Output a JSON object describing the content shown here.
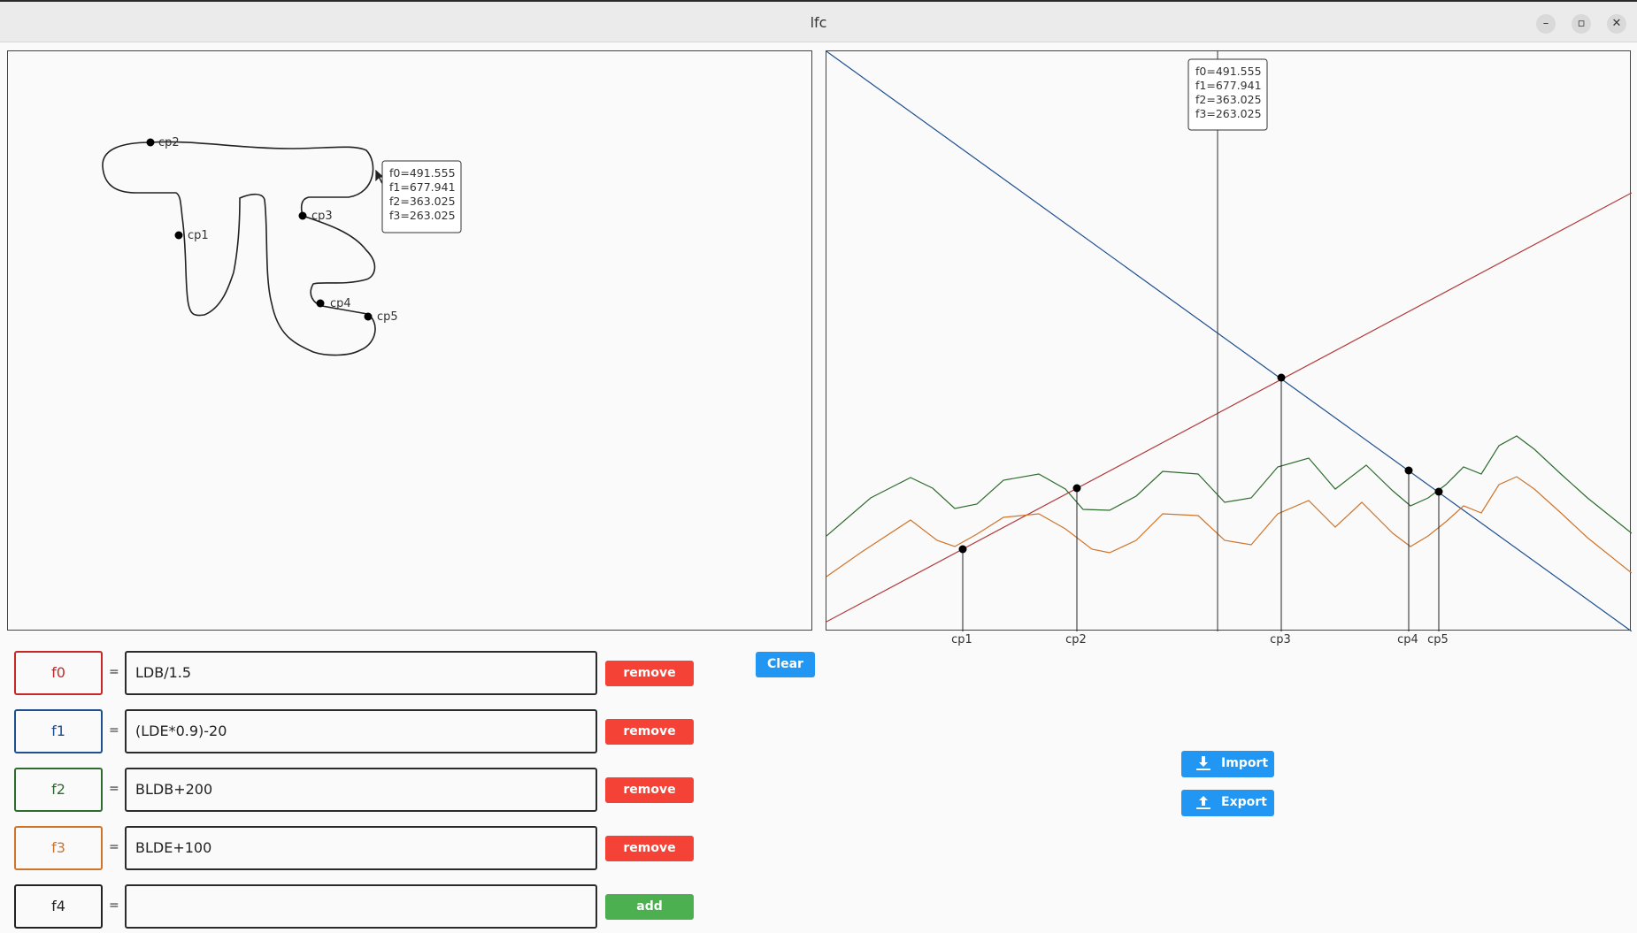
{
  "window": {
    "title": "lfc",
    "minimize_glyph": "–",
    "maximize_glyph": "▫",
    "close_glyph": "✕"
  },
  "draw_panel": {
    "clear_label": "Clear",
    "cp_labels": [
      "cp2",
      "cp1",
      "cp3",
      "cp4",
      "cp5"
    ],
    "tooltip": [
      "f0=491.555",
      "f1=677.941",
      "f2=363.025",
      "f3=263.025"
    ]
  },
  "plot_panel": {
    "tooltip": [
      "f0=491.555",
      "f1=677.941",
      "f2=363.025",
      "f3=263.025"
    ],
    "cp_labels": [
      "cp1",
      "cp2",
      "cp3",
      "cp4",
      "cp5"
    ]
  },
  "functions": [
    {
      "name": "f0",
      "expr": "LDB/1.5",
      "button": "remove",
      "color": "#c62828"
    },
    {
      "name": "f1",
      "expr": "(LDE*0.9)-20",
      "button": "remove",
      "color": "#1e4f91"
    },
    {
      "name": "f2",
      "expr": "BLDB+200",
      "button": "remove",
      "color": "#2e6b2e"
    },
    {
      "name": "f3",
      "expr": "BLDE+100",
      "button": "remove",
      "color": "#d0742a"
    },
    {
      "name": "f4",
      "expr": "",
      "button": "add",
      "color": "#222222"
    }
  ],
  "io": {
    "import_label": "Import",
    "export_label": "Export",
    "import_icon": "download-icon",
    "export_icon": "upload-icon"
  },
  "colors": {
    "accent": "#2196f3",
    "remove": "#f44336",
    "add": "#4caf50",
    "f0": "#c62828",
    "f1": "#1e4f91",
    "f2": "#2e6b2e",
    "f3": "#d0742a"
  }
}
